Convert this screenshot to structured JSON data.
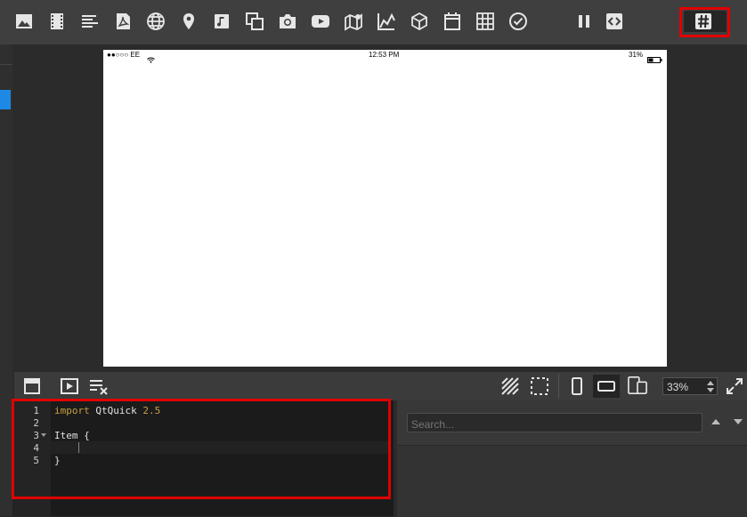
{
  "toolbar": {
    "icons": [
      "image-icon",
      "video-icon",
      "text-icon",
      "pdf-icon",
      "globe-icon",
      "map-pin-icon",
      "music-icon",
      "copy-icon",
      "camera-icon",
      "youtube-icon",
      "map-icon",
      "chart-icon",
      "cube-icon",
      "calendar-icon",
      "grid-icon",
      "check-circle-icon",
      "pause-icon",
      "code-icon",
      "hash-icon"
    ]
  },
  "device": {
    "carrier": "●●○○○ EE",
    "time": "12:53 PM",
    "battery": "31%"
  },
  "zoom": {
    "value": "33%"
  },
  "editor": {
    "line_numbers": [
      "1",
      "2",
      "3",
      "4",
      "5"
    ],
    "lines": {
      "l1_keyword": "import",
      "l1_module": "QtQuick",
      "l1_version": "2.5",
      "l3_type": "Item",
      "l3_brace": "{",
      "l5_brace": "}"
    }
  },
  "search": {
    "placeholder": "Search..."
  },
  "colors": {
    "accent_blue": "#1e88e5",
    "highlight_red": "#e00000",
    "keyword": "#c8a040",
    "version": "#c8a040"
  }
}
